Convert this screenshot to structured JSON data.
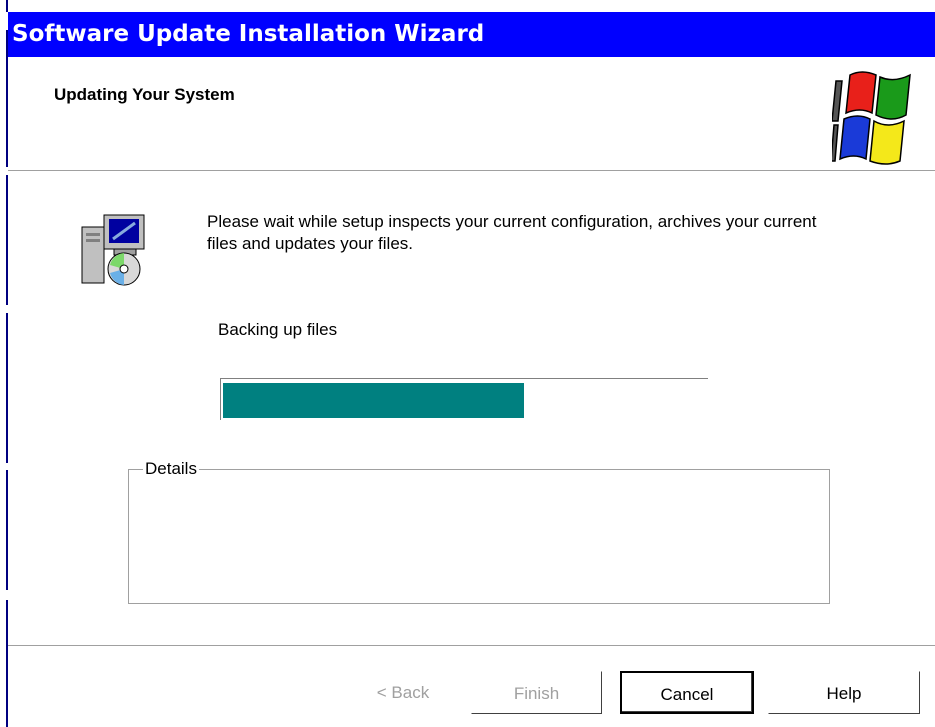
{
  "window": {
    "title": "Software Update Installation Wizard"
  },
  "header": {
    "title": "Updating Your System",
    "logo_icon": "windows-flag-icon"
  },
  "body": {
    "setup_icon": "setup-computer-cd-icon",
    "intro_text": "Please wait while setup inspects your current configuration, archives your current files and updates your files.",
    "stage_text": "Backing up files",
    "progress_percent": 62,
    "progress_color": "#008080"
  },
  "details": {
    "label": "Details",
    "content": ""
  },
  "buttons": {
    "back": "< Back",
    "finish": "Finish",
    "cancel": "Cancel",
    "help": "Help"
  },
  "colors": {
    "titlebar": "#0000ff",
    "titlebar_text": "#ffffff"
  }
}
